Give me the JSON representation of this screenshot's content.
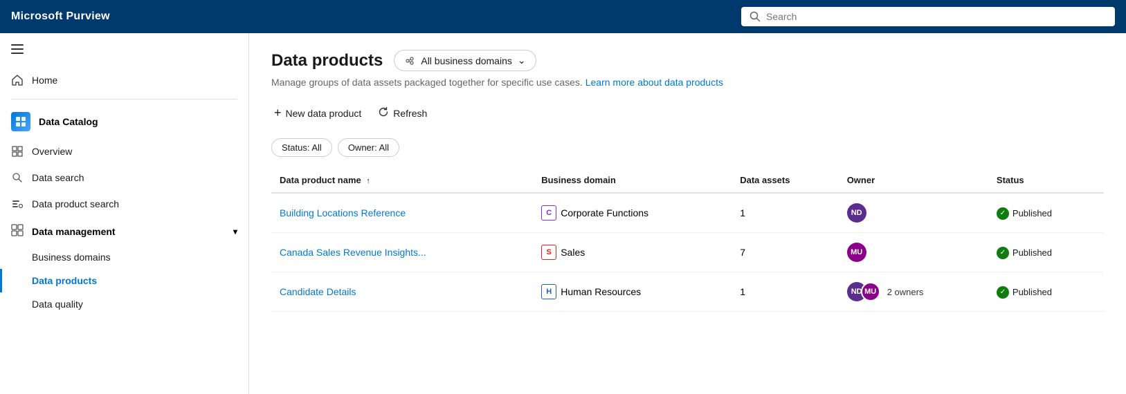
{
  "topbar": {
    "title": "Microsoft Purview",
    "search_placeholder": "Search"
  },
  "sidebar": {
    "hamburger_label": "Menu",
    "home_label": "Home",
    "data_catalog_label": "Data Catalog",
    "overview_label": "Overview",
    "data_search_label": "Data search",
    "data_product_search_label": "Data product search",
    "data_management_label": "Data management",
    "business_domains_label": "Business domains",
    "data_products_label": "Data products",
    "data_quality_label": "Data quality"
  },
  "content": {
    "page_title": "Data products",
    "domain_button": "All business domains",
    "subtitle": "Manage groups of data assets packaged together for specific use cases.",
    "learn_more": "Learn more about data products",
    "new_data_product_label": "New data product",
    "refresh_label": "Refresh",
    "filter_status": "Status: All",
    "filter_owner": "Owner: All",
    "table": {
      "col_name": "Data product name",
      "col_domain": "Business domain",
      "col_assets": "Data assets",
      "col_owner": "Owner",
      "col_status": "Status"
    },
    "rows": [
      {
        "name": "Building Locations Reference",
        "domain_code": "C",
        "domain_label": "Corporate Functions",
        "domain_class": "corp",
        "assets": "1",
        "owner_initials": "ND",
        "owner_class": "avatar-nd",
        "owner_count": null,
        "status": "Published"
      },
      {
        "name": "Canada Sales Revenue Insights...",
        "domain_code": "S",
        "domain_label": "Sales",
        "domain_class": "sales",
        "assets": "7",
        "owner_initials": "MU",
        "owner_class": "avatar-mu",
        "owner_count": null,
        "status": "Published"
      },
      {
        "name": "Candidate Details",
        "domain_code": "H",
        "domain_label": "Human Resources",
        "domain_class": "hr",
        "assets": "1",
        "owner_initials_1": "ND",
        "owner_class_1": "avatar-nd",
        "owner_initials_2": "MU",
        "owner_class_2": "avatar-mu",
        "owner_count": "2 owners",
        "status": "Published"
      }
    ]
  }
}
